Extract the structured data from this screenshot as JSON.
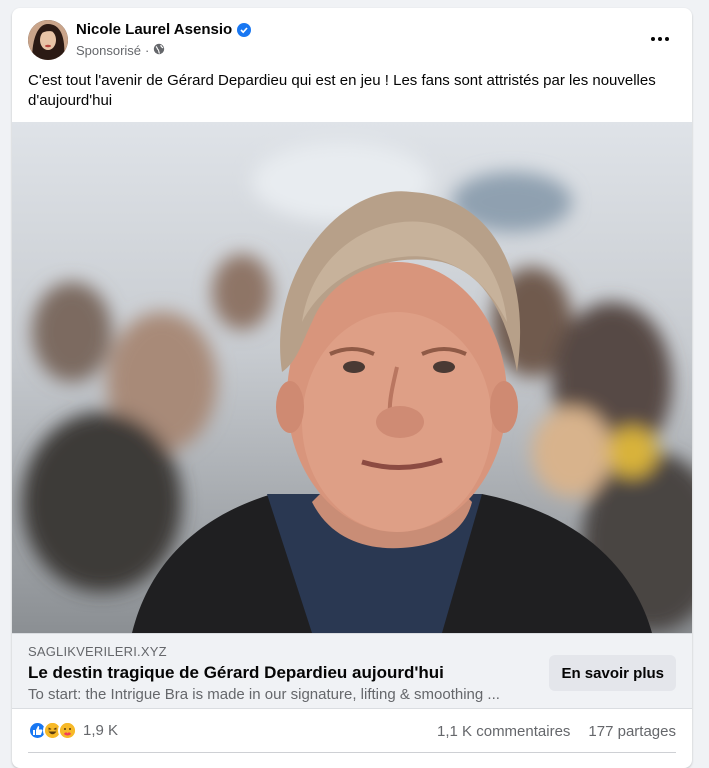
{
  "post": {
    "author": "Nicole Laurel Asensio",
    "sponsored_label": "Sponsorisé",
    "separator": "·",
    "text": "C'est tout l'avenir de Gérard Depardieu qui est en jeu ! Les fans sont attristés par les nouvelles d'aujourd'hui"
  },
  "link": {
    "domain": "SAGLIKVERILERI.XYZ",
    "title": "Le destin tragique de Gérard Depardieu aujourd'hui",
    "description": "To start: the Intrigue Bra is made in our signature, lifting & smoothing ...",
    "cta_label": "En savoir plus"
  },
  "stats": {
    "reactions_count": "1,9 K",
    "comments": "1,1 K commentaires",
    "shares": "177 partages"
  },
  "icons": {
    "verified": "verified-badge-icon",
    "privacy": "globe-icon",
    "menu": "more-horizontal-icon",
    "reactions": [
      "like-icon",
      "haha-icon",
      "care-icon"
    ]
  },
  "colors": {
    "accent": "#1877f2",
    "secondary_text": "#65676b",
    "link_background": "#f0f2f5"
  }
}
